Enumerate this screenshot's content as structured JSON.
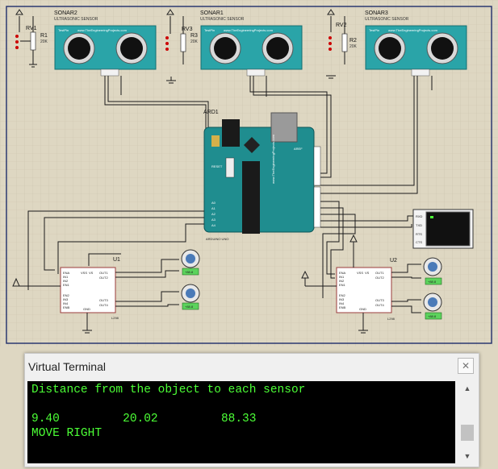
{
  "schematic": {
    "sonars": [
      {
        "name": "SONAR2",
        "type": "ULTRASONIC SENSOR"
      },
      {
        "name": "SONAR1",
        "type": "ULTRASONIC SENSOR"
      },
      {
        "name": "SONAR3",
        "type": "ULTRASONIC SENSOR"
      }
    ],
    "sonar_brand": "www.TheEngineeringProjects.com",
    "sonar_tag": "TestPin",
    "pots": [
      {
        "name": "RV1",
        "res": "R1",
        "val": "20K"
      },
      {
        "name": "RV3",
        "res": "R3",
        "val": "20K"
      },
      {
        "name": "RV2",
        "res": "R2",
        "val": "20K"
      }
    ],
    "arduino": {
      "ref": "ARD1",
      "name": "ARDUINO UNO",
      "brand": "www.TheEngineeringProjects.com",
      "reset": "RESET",
      "aref": "AREF"
    },
    "drivers": [
      {
        "ref": "U1",
        "part": "L298"
      },
      {
        "ref": "U2",
        "part": "L298"
      }
    ],
    "driver_pins_left": [
      "ENA",
      "IN1",
      "IN2",
      "EN1",
      "EN2",
      "IN3",
      "IN4",
      "ENB"
    ],
    "driver_pins_right": [
      "VS",
      "OUT1",
      "OUT2",
      "OUT3",
      "OUT4"
    ],
    "driver_pins_top": [
      "VSS",
      "VS"
    ],
    "driver_pin_bottom": "GND",
    "terminal_pins": [
      "RXD",
      "TXD",
      "RTS",
      "CTS"
    ],
    "motor_label": "+88.8"
  },
  "terminal": {
    "title": "Virtual Terminal",
    "close_icon": "close-icon",
    "lines": [
      "Distance from the object to each sensor",
      "",
      "9.40         20.02         88.33",
      "MOVE RIGHT"
    ],
    "scroll_up_icon": "chevron-up-icon",
    "scroll_down_icon": "chevron-down-icon"
  },
  "colors": {
    "canvas": "#ded7c2",
    "sheet_border": "#1f2d6b",
    "sonar_board": "#2aa4a8",
    "arduino_board": "#1f8d8f",
    "terminal_bg": "#000000",
    "terminal_text": "#4cff36"
  }
}
